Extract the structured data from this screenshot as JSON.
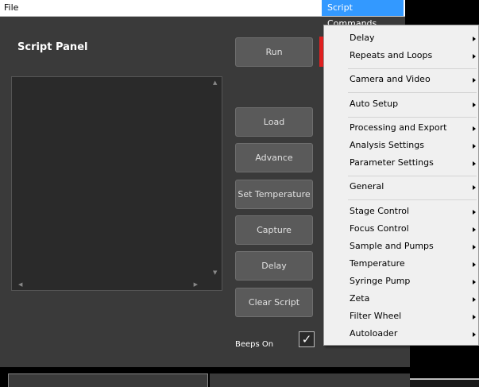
{
  "menubar": {
    "file_label": "File",
    "script_commands_label": "Script Commands"
  },
  "panel": {
    "title": "Script Panel"
  },
  "buttons": {
    "run": "Run",
    "load": "Load",
    "advance": "Advance",
    "set_temperature": "Set Temperature",
    "capture": "Capture",
    "delay": "Delay",
    "clear_script": "Clear Script"
  },
  "beeps": {
    "label": "Beeps On",
    "checked": true,
    "check_glyph": "✓"
  },
  "script_commands_menu": {
    "items": [
      {
        "label": "Delay",
        "has_submenu": true
      },
      {
        "label": "Repeats and Loops",
        "has_submenu": true
      },
      {
        "label": "Camera and Video",
        "has_submenu": true
      },
      {
        "label": "Auto Setup",
        "has_submenu": true
      },
      {
        "label": "Processing and Export",
        "has_submenu": true
      },
      {
        "label": "Analysis Settings",
        "has_submenu": true
      },
      {
        "label": "Parameter Settings",
        "has_submenu": true
      },
      {
        "label": "General",
        "has_submenu": true
      },
      {
        "label": "Stage Control",
        "has_submenu": true
      },
      {
        "label": "Focus Control",
        "has_submenu": true
      },
      {
        "label": "Sample and Pumps",
        "has_submenu": true
      },
      {
        "label": "Temperature",
        "has_submenu": true
      },
      {
        "label": "Syringe Pump",
        "has_submenu": true
      },
      {
        "label": "Zeta",
        "has_submenu": true
      },
      {
        "label": "Filter Wheel",
        "has_submenu": true
      },
      {
        "label": "Autoloader",
        "has_submenu": true
      }
    ]
  },
  "colors": {
    "menu_highlight": "#3399ff",
    "run_accent": "#e02020",
    "panel_bg": "#3a3a3a"
  }
}
